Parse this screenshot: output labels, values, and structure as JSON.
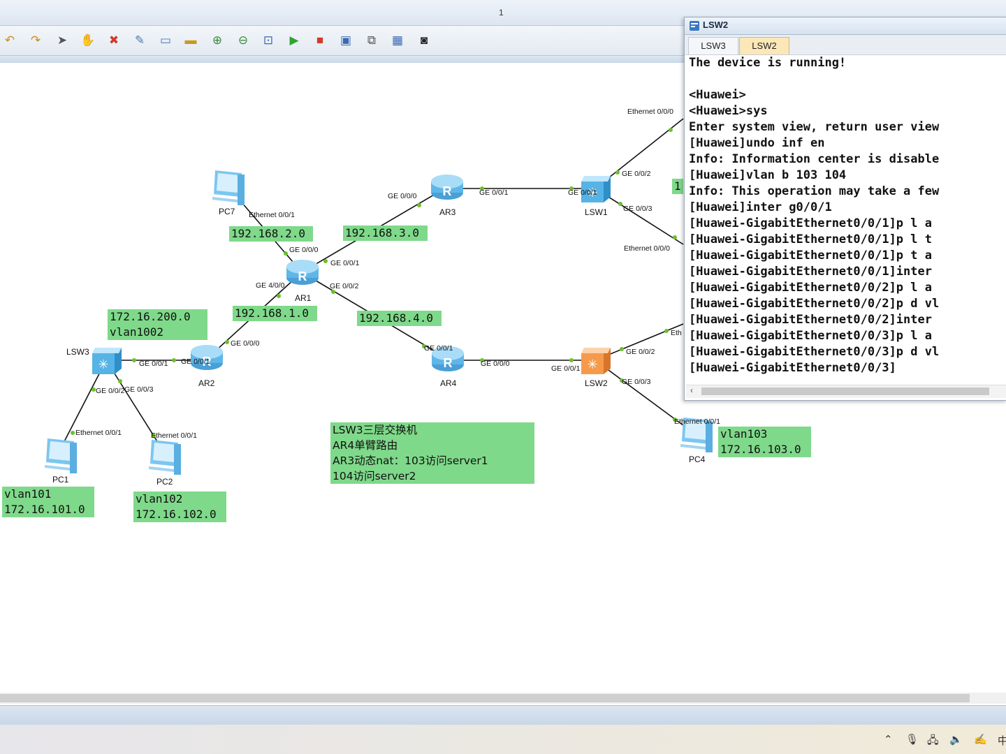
{
  "window": {
    "page_indicator": "1"
  },
  "toolbar": {
    "icons": [
      "undo-icon",
      "redo-icon",
      "select-icon",
      "hand-icon",
      "delete-icon",
      "delete-link-icon",
      "text-note-icon",
      "rectangle-icon",
      "zoom-in-icon",
      "zoom-out-icon",
      "fit-icon",
      "start-icon",
      "stop-icon",
      "capture-icon",
      "topology-icon",
      "grid-icon",
      "screenshot-icon"
    ]
  },
  "topology": {
    "devices": {
      "pc7": "PC7",
      "ar1": "AR1",
      "ar2": "AR2",
      "ar3": "AR3",
      "ar4": "AR4",
      "lsw1": "LSW1",
      "lsw2": "LSW2",
      "lsw3": "LSW3",
      "pc1": "PC1",
      "pc2": "PC2",
      "pc4": "PC4"
    },
    "ports": {
      "pc7_eth": "Ethernet 0/0/1",
      "ar1_g000": "GE 0/0/0",
      "ar1_g001": "GE 0/0/1",
      "ar1_g002": "GE 0/0/2",
      "ar1_g400": "GE 4/0/0",
      "ar3_g000": "GE 0/0/0",
      "ar3_g001": "GE 0/0/1",
      "lsw1_g001": "GE 0/0/1",
      "lsw1_g002": "GE 0/0/2",
      "lsw1_g003": "GE 0/0/3",
      "lsw1_eth_top": "Ethernet 0/0/0",
      "lsw1_eth_bottom": "Ethernet 0/0/0",
      "ar2_g000": "GE 0/0/0",
      "ar2_g001": "GE 0/0/1",
      "lsw3_g001": "GE 0/0/1",
      "lsw3_g002": "GE 0/0/2",
      "lsw3_g003": "GE 0/0/3",
      "pc1_eth": "Ethernet 0/0/1",
      "pc2_eth": "Ethernet 0/0/1",
      "ar4_g001": "GE 0/0/1",
      "ar4_g000": "GE 0/0/0",
      "lsw2_g001": "GE 0/0/1",
      "lsw2_g002": "GE 0/0/2",
      "lsw2_g003": "GE 0/0/3",
      "lsw2_eth_partial": "Eth",
      "pc4_eth": "Ethernet 0/0/1"
    },
    "notes": {
      "net_192_168_2": "192.168.2.0",
      "net_192_168_3": "192.168.3.0",
      "net_192_168_1": "192.168.1.0",
      "net_192_168_4": "192.168.4.0",
      "net_vlan1002": "172.16.200.0\nvlan1002",
      "net_vlan101": "vlan101\n172.16.101.0",
      "net_vlan102": "vlan102\n172.16.102.0",
      "net_vlan103": "vlan103\n172.16.103.0",
      "partial_1": "1",
      "description": "LSW3三层交换机\nAR4单臂路由\nAR3动态nat：103访问server1\n104访问server2"
    }
  },
  "cli_window": {
    "title": "LSW2",
    "tabs": [
      {
        "label": "LSW3",
        "active": false
      },
      {
        "label": "LSW2",
        "active": true
      }
    ],
    "lines": [
      "The device is running!",
      "",
      "<Huawei>",
      "<Huawei>sys",
      "Enter system view, return user view",
      "[Huawei]undo inf en",
      "Info: Information center is disable",
      "[Huawei]vlan b 103 104",
      "Info: This operation may take a few",
      "[Huawei]inter g0/0/1",
      "[Huawei-GigabitEthernet0/0/1]p l a",
      "[Huawei-GigabitEthernet0/0/1]p l t",
      "[Huawei-GigabitEthernet0/0/1]p t a",
      "[Huawei-GigabitEthernet0/0/1]inter",
      "[Huawei-GigabitEthernet0/0/2]p l a",
      "[Huawei-GigabitEthernet0/0/2]p d vl",
      "[Huawei-GigabitEthernet0/0/2]inter",
      "[Huawei-GigabitEthernet0/0/3]p l a",
      "[Huawei-GigabitEthernet0/0/3]p d vl",
      "[Huawei-GigabitEthernet0/0/3]"
    ]
  },
  "taskbar": {
    "ime": "中"
  },
  "colors": {
    "note_bg": "#7fd98a",
    "active_tab": "#fbe7b7",
    "link": "#111111",
    "port_dot": "#6dbf2a"
  }
}
